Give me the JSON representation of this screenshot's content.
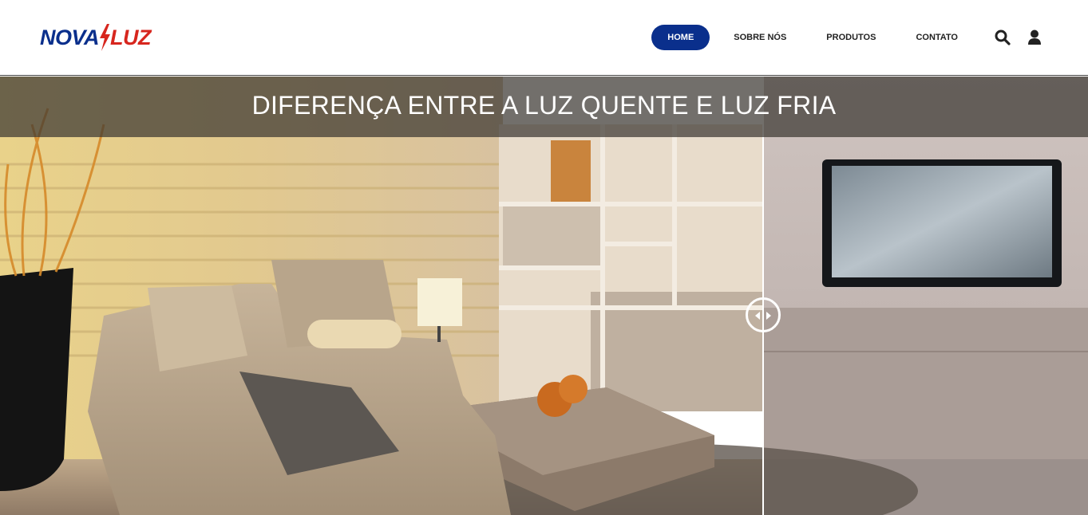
{
  "brand": {
    "logo_part1": "NOVA",
    "logo_part2": "LUZ",
    "primary_color": "#0a2f8c",
    "accent_color": "#d7261e"
  },
  "nav": {
    "items": [
      {
        "label": "HOME",
        "active": true
      },
      {
        "label": "SOBRE NÓS",
        "active": false
      },
      {
        "label": "PRODUTOS",
        "active": false
      },
      {
        "label": "CONTATO",
        "active": false
      }
    ],
    "icons": [
      "search-icon",
      "user-icon"
    ]
  },
  "hero": {
    "title": "DIFERENÇA ENTRE A LUZ QUENTE E LUZ FRIA",
    "slider_position": 0.7,
    "left_tone": "warm",
    "right_tone": "cool"
  }
}
